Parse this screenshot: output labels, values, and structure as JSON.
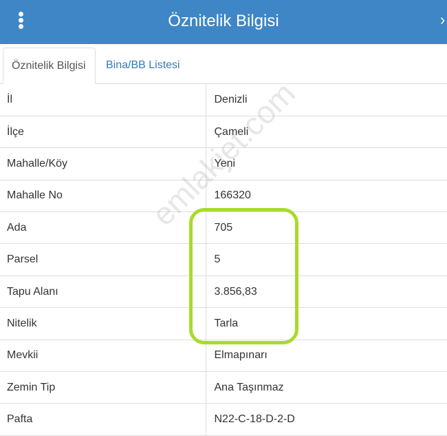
{
  "header": {
    "title": "Öznitelik Bilgisi",
    "colors": {
      "bar": "#3f86c6",
      "text": "#ffffff"
    },
    "menu_icon": "vertical-ellipsis-icon",
    "collapse_icon": "collapse-chevron-icon"
  },
  "tabs": [
    {
      "label": "Öznitelik Bilgisi",
      "active": true
    },
    {
      "label": "Bina/BB Listesi",
      "active": false
    }
  ],
  "rows": [
    {
      "label": "İl",
      "value": "Denizli"
    },
    {
      "label": "İlçe",
      "value": "Çameli"
    },
    {
      "label": "Mahalle/Köy",
      "value": "Yeni"
    },
    {
      "label": "Mahalle No",
      "value": "166320"
    },
    {
      "label": "Ada",
      "value": "705"
    },
    {
      "label": "Parsel",
      "value": "5"
    },
    {
      "label": "Tapu Alanı",
      "value": "3.856,83"
    },
    {
      "label": "Nitelik",
      "value": "Tarla"
    },
    {
      "label": "Mevkii",
      "value": "Elmapınarı"
    },
    {
      "label": "Zemin Tip",
      "value": "Ana Taşınmaz"
    },
    {
      "label": "Pafta",
      "value": "N22-C-18-D-2-D"
    }
  ],
  "watermark": "emlakjet.com",
  "highlight": {
    "color": "#a7dc2a"
  }
}
